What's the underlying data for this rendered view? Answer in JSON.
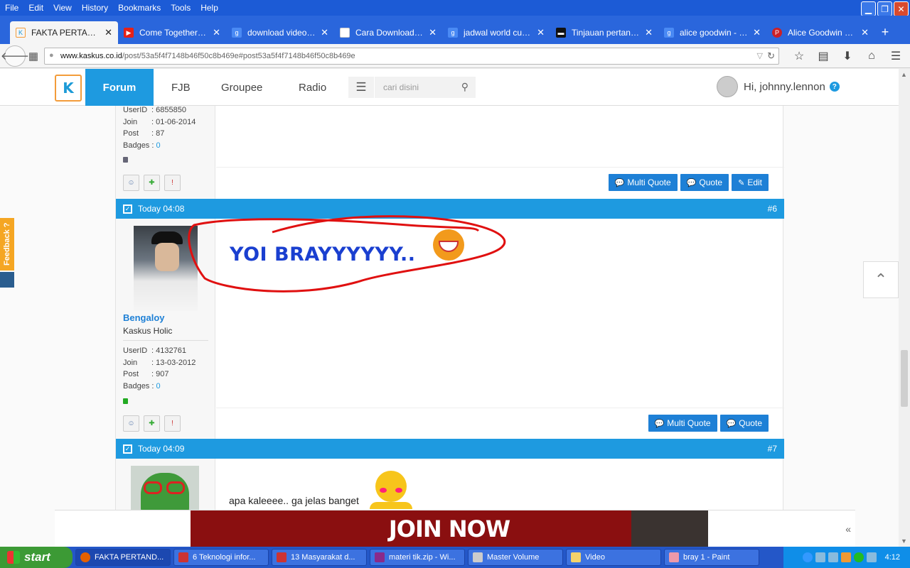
{
  "menubar": {
    "items": [
      "File",
      "Edit",
      "View",
      "History",
      "Bookmarks",
      "Tools",
      "Help"
    ]
  },
  "tabs": [
    {
      "title": "FAKTA PERTAND...",
      "fav": "kaskus-icon",
      "color": "#f39c3a"
    },
    {
      "title": "Come Together B...",
      "fav": "youtube-icon",
      "color": "#e62117"
    },
    {
      "title": "download video d...",
      "fav": "google-icon",
      "color": "#4a8af4"
    },
    {
      "title": "Cara Download Vi...",
      "fav": "grid-icon",
      "color": "#ffffff"
    },
    {
      "title": "jadwal world cup ...",
      "fav": "google-icon",
      "color": "#4a8af4"
    },
    {
      "title": "Tinjauan pertandi...",
      "fav": "site-icon",
      "color": "#111111"
    },
    {
      "title": "alice goodwin - G...",
      "fav": "google-icon",
      "color": "#4a8af4"
    },
    {
      "title": "Alice Goodwin on ...",
      "fav": "pinterest-icon",
      "color": "#cb2027"
    }
  ],
  "url": {
    "domain": "www.kaskus.co.id",
    "path": "/post/53a5f4f7148b46f50c8b469e#post53a5f4f7148b46f50c8b469e"
  },
  "kaskus": {
    "logo": "K",
    "nav": [
      "Forum",
      "FJB",
      "Groupee",
      "Radio"
    ],
    "search_placeholder": "cari disini",
    "greeting": "Hi, johnny.lennon",
    "help": "?"
  },
  "post5": {
    "userid": "6855850",
    "join": "01-06-2014",
    "post": "87",
    "badges": "0",
    "actions": [
      "Multi Quote",
      "Quote",
      "Edit"
    ]
  },
  "post6": {
    "time": "Today 04:08",
    "number": "#6",
    "username": "Bengaloy",
    "rank": "Kaskus Holic",
    "userid": "4132761",
    "join": "13-03-2012",
    "post": "907",
    "badges": "0",
    "message": "YOI BRAYYYYYY..",
    "actions": [
      "Multi Quote",
      "Quote"
    ]
  },
  "post7": {
    "time": "Today 04:09",
    "number": "#7",
    "message": "apa kaleeee.. ga jelas banget"
  },
  "labels": {
    "userid": "UserID",
    "join": "Join",
    "post": "Post",
    "badges": "Badges"
  },
  "feedback": "Feedback ?",
  "ad": {
    "text": "JOIN NOW"
  },
  "taskbar": {
    "start": "start",
    "tasks": [
      "FAKTA PERTAND...",
      "6 Teknologi infor...",
      "13 Masyarakat d...",
      "materi tik.zip - Wi...",
      "Master Volume",
      "Video",
      "bray 1 - Paint"
    ],
    "clock": "4:12"
  }
}
